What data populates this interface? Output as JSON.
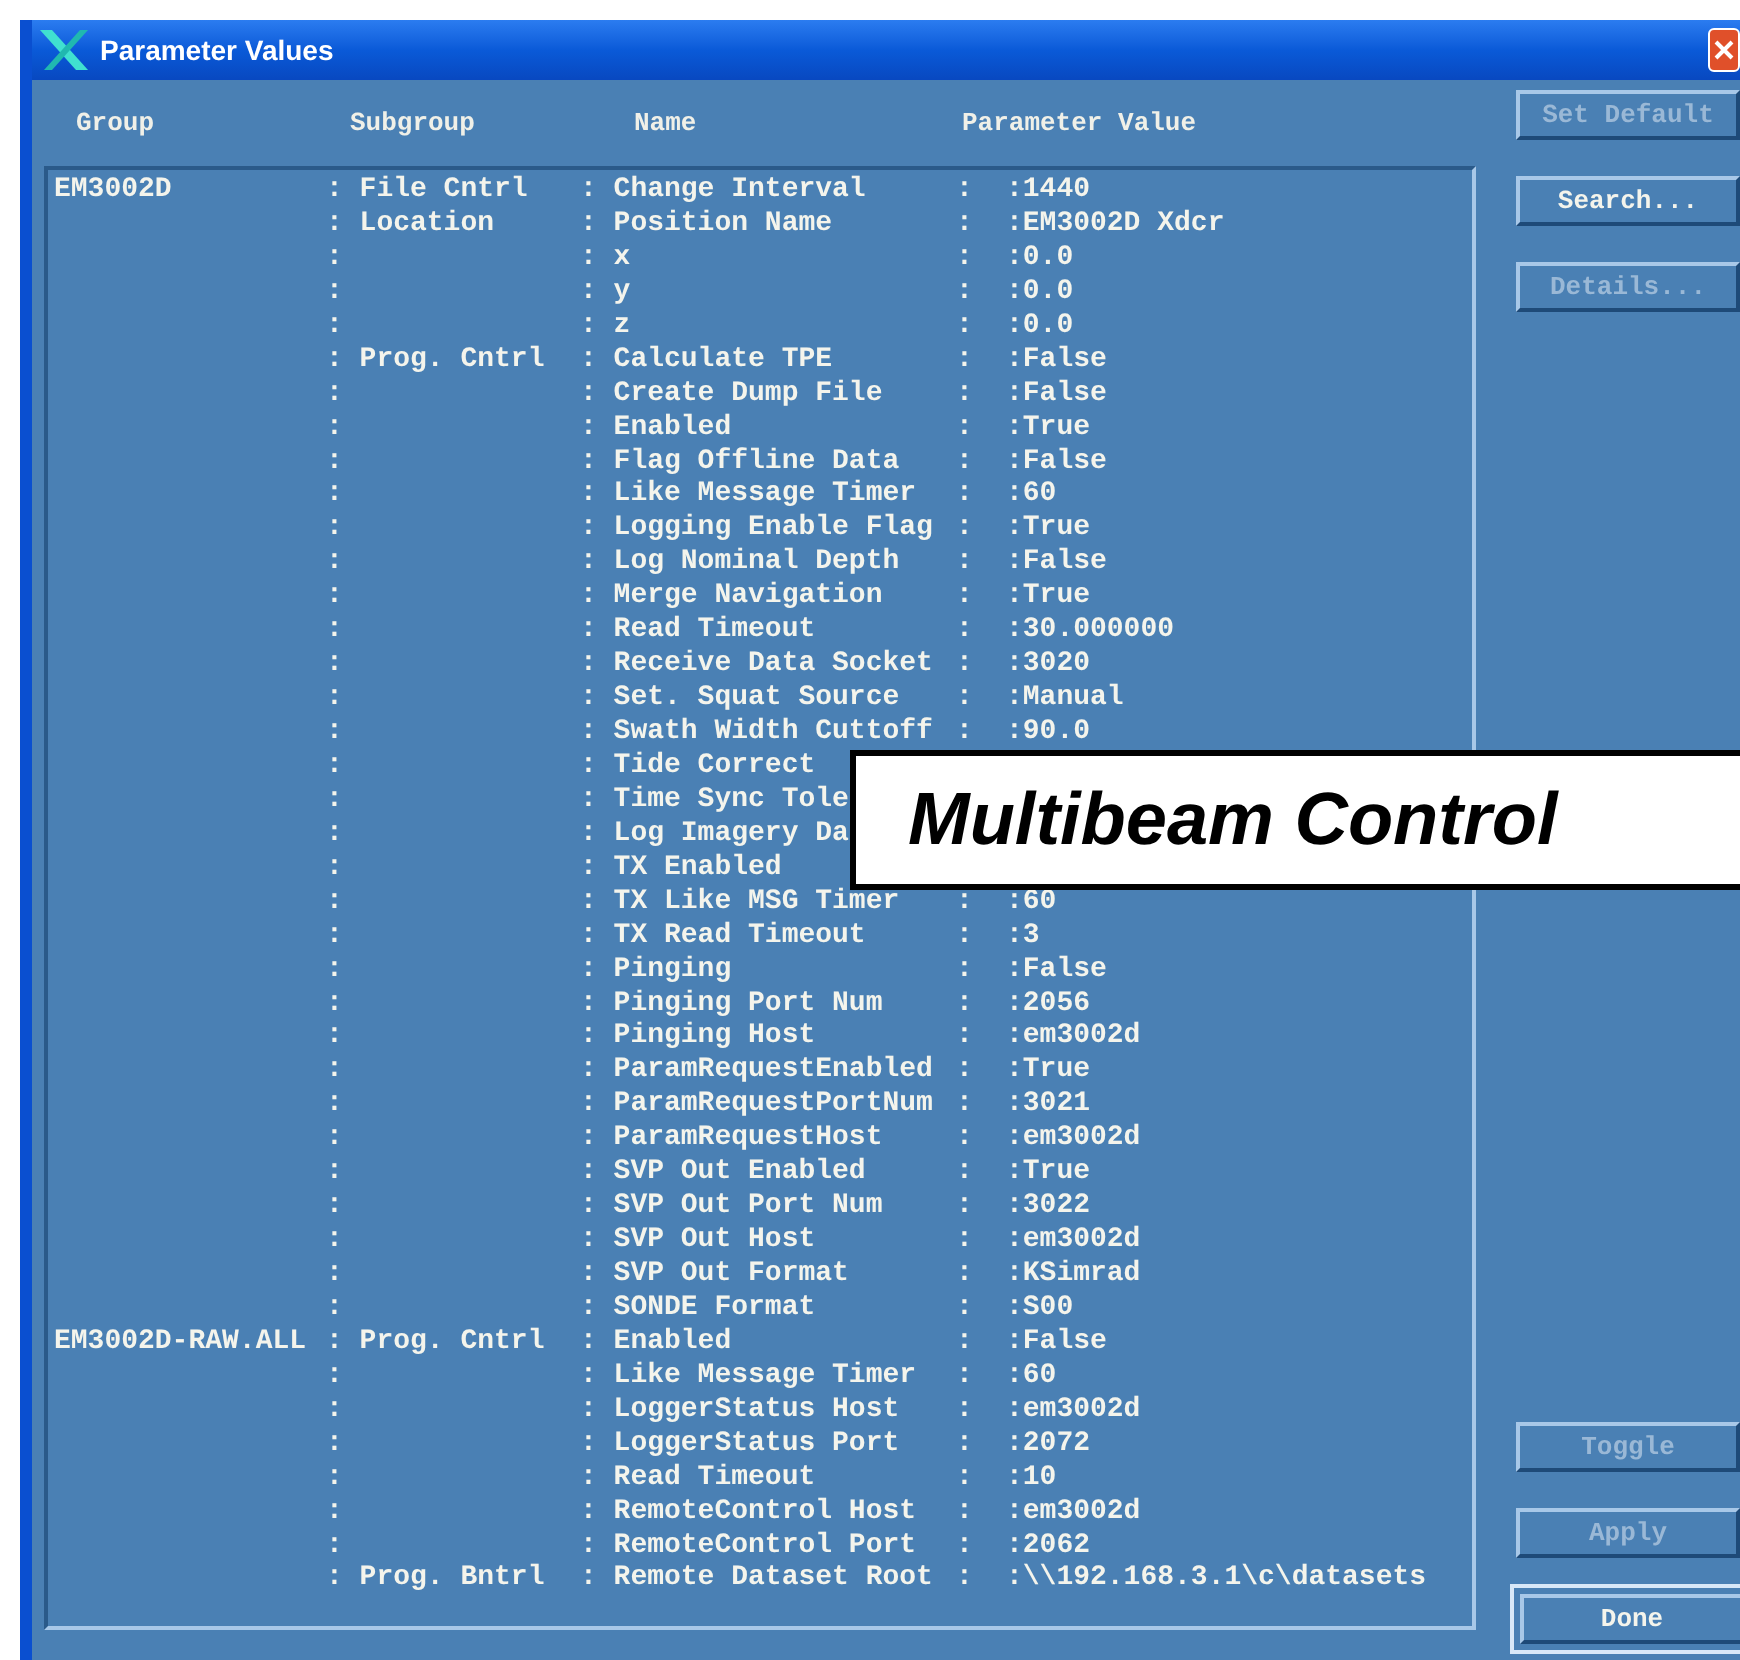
{
  "window": {
    "title": "Parameter Values"
  },
  "columns": [
    "Group",
    "Subgroup",
    "Name",
    "Parameter Value"
  ],
  "rows": [
    {
      "group": "EM3002D",
      "subgroup": ": File Cntrl",
      "name": ": Change Interval",
      "sep": ":",
      "value": ":1440"
    },
    {
      "subgroup": ": Location",
      "name": ": Position Name",
      "sep": ":",
      "value": ":EM3002D Xdcr"
    },
    {
      "subgroup": ":",
      "name": ": x",
      "sep": ":",
      "value": ":0.0"
    },
    {
      "subgroup": ":",
      "name": ": y",
      "sep": ":",
      "value": ":0.0"
    },
    {
      "subgroup": ":",
      "name": ": z",
      "sep": ":",
      "value": ":0.0"
    },
    {
      "subgroup": ": Prog. Cntrl",
      "name": ": Calculate TPE",
      "sep": ":",
      "value": ":False"
    },
    {
      "subgroup": ":",
      "name": ": Create Dump File",
      "sep": ":",
      "value": ":False"
    },
    {
      "subgroup": ":",
      "name": ": Enabled",
      "sep": ":",
      "value": ":True"
    },
    {
      "subgroup": ":",
      "name": ": Flag Offline Data",
      "sep": ":",
      "value": ":False"
    },
    {
      "subgroup": ":",
      "name": ": Like Message Timer",
      "sep": ":",
      "value": ":60"
    },
    {
      "subgroup": ":",
      "name": ": Logging Enable Flag",
      "sep": ":",
      "value": ":True"
    },
    {
      "subgroup": ":",
      "name": ": Log Nominal Depth",
      "sep": ":",
      "value": ":False"
    },
    {
      "subgroup": ":",
      "name": ": Merge Navigation",
      "sep": ":",
      "value": ":True"
    },
    {
      "subgroup": ":",
      "name": ": Read Timeout",
      "sep": ":",
      "value": ":30.000000"
    },
    {
      "subgroup": ":",
      "name": ": Receive Data Socket",
      "sep": ":",
      "value": ":3020"
    },
    {
      "subgroup": ":",
      "name": ": Set. Squat Source",
      "sep": ":",
      "value": ":Manual"
    },
    {
      "subgroup": ":",
      "name": ": Swath Width Cuttoff",
      "sep": ":",
      "value": ":90.0"
    },
    {
      "subgroup": ":",
      "name": ": Tide Correct"
    },
    {
      "subgroup": ":",
      "name": ": Time Sync Tole"
    },
    {
      "subgroup": ":",
      "name": ": Log Imagery Da"
    },
    {
      "subgroup": ":",
      "name": ": TX Enabled"
    },
    {
      "subgroup": ":",
      "name": ": TX Like MSG Timer",
      "sep": ":",
      "value": ":60"
    },
    {
      "subgroup": ":",
      "name": ": TX Read Timeout",
      "sep": ":",
      "value": ":3"
    },
    {
      "subgroup": ":",
      "name": ": Pinging",
      "sep": ":",
      "value": ":False"
    },
    {
      "subgroup": ":",
      "name": ": Pinging Port Num",
      "sep": ":",
      "value": ":2056"
    },
    {
      "subgroup": ":",
      "name": ": Pinging Host",
      "sep": ":",
      "value": ":em3002d"
    },
    {
      "subgroup": ":",
      "name": ": ParamRequestEnabled",
      "sep": ":",
      "value": ":True"
    },
    {
      "subgroup": ":",
      "name": ": ParamRequestPortNum",
      "sep": ":",
      "value": ":3021"
    },
    {
      "subgroup": ":",
      "name": ": ParamRequestHost",
      "sep": ":",
      "value": ":em3002d"
    },
    {
      "subgroup": ":",
      "name": ": SVP Out Enabled",
      "sep": ":",
      "value": ":True"
    },
    {
      "subgroup": ":",
      "name": ": SVP Out Port Num",
      "sep": ":",
      "value": ":3022"
    },
    {
      "subgroup": ":",
      "name": ": SVP Out Host",
      "sep": ":",
      "value": ":em3002d"
    },
    {
      "subgroup": ":",
      "name": ": SVP Out Format",
      "sep": ":",
      "value": ":KSimrad"
    },
    {
      "subgroup": ":",
      "name": ": SONDE Format",
      "sep": ":",
      "value": ":S00"
    },
    {
      "group": "EM3002D-RAW.ALL",
      "subgroup": ": Prog. Cntrl",
      "name": ": Enabled",
      "sep": ":",
      "value": ":False"
    },
    {
      "subgroup": ":",
      "name": ": Like Message Timer",
      "sep": ":",
      "value": ":60"
    },
    {
      "subgroup": ":",
      "name": ": LoggerStatus Host",
      "sep": ":",
      "value": ":em3002d"
    },
    {
      "subgroup": ":",
      "name": ": LoggerStatus Port",
      "sep": ":",
      "value": ":2072"
    },
    {
      "subgroup": ":",
      "name": ": Read Timeout",
      "sep": ":",
      "value": ":10"
    },
    {
      "subgroup": ":",
      "name": ": RemoteControl Host",
      "sep": ":",
      "value": ":em3002d"
    },
    {
      "subgroup": ":",
      "name": ": RemoteControl Port",
      "sep": ":",
      "value": ":2062"
    },
    {
      "subgroup": ": Prog. Bntrl",
      "name": ": Remote Dataset Root",
      "sep": ":",
      "value": ":\\\\192.168.3.1\\c\\datasets"
    }
  ],
  "buttons_top": [
    {
      "label": "Set Default",
      "disabled": true,
      "default": false
    },
    {
      "label": "Search...",
      "disabled": false,
      "default": false
    },
    {
      "label": "Details...",
      "disabled": true,
      "default": false
    }
  ],
  "buttons_bottom": [
    {
      "label": "Toggle",
      "disabled": true,
      "default": false
    },
    {
      "label": "Apply",
      "disabled": true,
      "default": false
    },
    {
      "label": "Done",
      "disabled": false,
      "default": true
    }
  ],
  "banner": {
    "text": "Multibeam Control"
  }
}
